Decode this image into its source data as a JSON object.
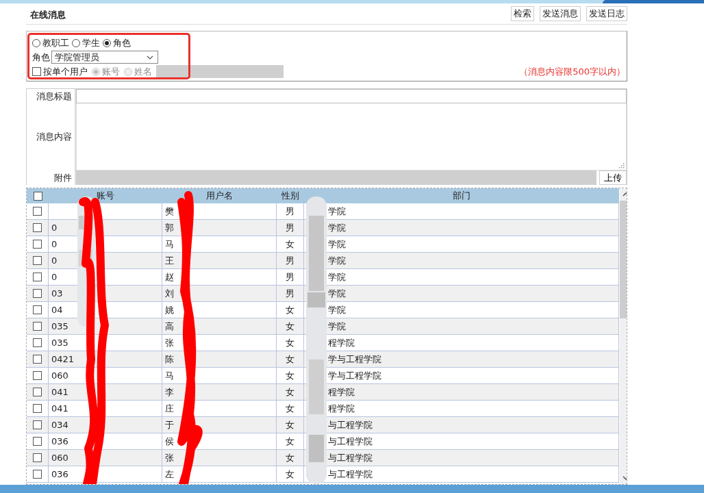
{
  "page": {
    "title": "在线消息"
  },
  "toolbar": {
    "buttons": [
      "检索",
      "发送消息",
      "发送日志"
    ]
  },
  "recipient_filter": {
    "types": [
      {
        "label": "教职工",
        "selected": false
      },
      {
        "label": "学生",
        "selected": false
      },
      {
        "label": "角色",
        "selected": true
      }
    ],
    "role_label": "角色",
    "role_value": "学院管理员",
    "single_user": {
      "label": "按单个用户",
      "checked": false
    },
    "search_by": [
      {
        "label": "账号",
        "selected": true,
        "disabled": true
      },
      {
        "label": "姓名",
        "selected": false,
        "disabled": true
      }
    ],
    "note": "（消息内容限500字以内）"
  },
  "message_form": {
    "title_label": "消息标题",
    "content_label": "消息内容",
    "attachment_label": "附件",
    "upload_button": "上传"
  },
  "table": {
    "columns": [
      "账号",
      "用户名",
      "性别",
      "部门"
    ],
    "header_checked": false,
    "rows": [
      {
        "checked": false,
        "name": "樊",
        "gender": "男",
        "department": "学院"
      },
      {
        "checked": false,
        "account": "0",
        "name": "郭",
        "gender": "男",
        "department": "学院"
      },
      {
        "checked": false,
        "account": "0",
        "name": "马",
        "gender": "女",
        "department": "学院"
      },
      {
        "checked": false,
        "account": "0",
        "name": "王",
        "gender": "男",
        "department": "学院"
      },
      {
        "checked": false,
        "account": "0",
        "name": "赵",
        "gender": "男",
        "department": "学院"
      },
      {
        "checked": false,
        "account": "03",
        "name": "刘",
        "gender": "男",
        "department": "学院"
      },
      {
        "checked": false,
        "account": "04",
        "name": "姚",
        "gender": "女",
        "department": "学院"
      },
      {
        "checked": false,
        "account": "035",
        "name": "高",
        "gender": "女",
        "department": "学院"
      },
      {
        "checked": false,
        "account": "035",
        "name": "张",
        "gender": "女",
        "department": "程学院"
      },
      {
        "checked": false,
        "account": "0421",
        "name": "陈",
        "gender": "女",
        "department": "学与工程学院"
      },
      {
        "checked": false,
        "account": "060",
        "name": "马",
        "gender": "女",
        "department": "学与工程学院"
      },
      {
        "checked": false,
        "account": "041",
        "name": "李",
        "gender": "女",
        "department": "程学院"
      },
      {
        "checked": false,
        "account": "041",
        "name": "庄",
        "gender": "女",
        "department": "程学院"
      },
      {
        "checked": false,
        "account": "034",
        "name": "于",
        "gender": "女",
        "department": "与工程学院"
      },
      {
        "checked": false,
        "account": "036",
        "name": "侯",
        "gender": "女",
        "department": "与工程学院"
      },
      {
        "checked": false,
        "account": "060",
        "name": "张",
        "gender": "女",
        "department": "与工程学院"
      },
      {
        "checked": false,
        "account": "036",
        "name": "左",
        "gender": "女",
        "department": "与工程学院"
      }
    ]
  }
}
